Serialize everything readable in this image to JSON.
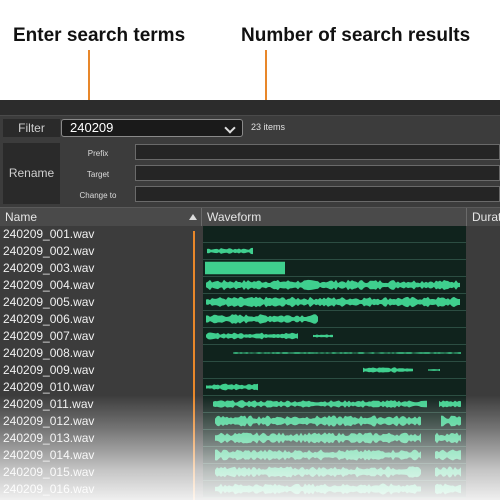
{
  "callouts": {
    "search_terms": "Enter search terms",
    "result_count": "Number of search results"
  },
  "filter": {
    "label": "Filter",
    "value": "240209",
    "count": "23 items"
  },
  "rename": {
    "label": "Rename",
    "fields": [
      {
        "label": "Prefix",
        "value": ""
      },
      {
        "label": "Target",
        "value": ""
      },
      {
        "label": "Change to",
        "value": ""
      }
    ]
  },
  "columns": [
    {
      "label": "Name",
      "sorted": "ascending"
    },
    {
      "label": "Waveform"
    },
    {
      "label": "Durat"
    }
  ],
  "files": [
    "240209_001.wav",
    "240209_002.wav",
    "240209_003.wav",
    "240209_004.wav",
    "240209_005.wav",
    "240209_006.wav",
    "240209_007.wav",
    "240209_008.wav",
    "240209_009.wav",
    "240209_010.wav",
    "240209_011.wav",
    "240209_012.wav",
    "240209_013.wav",
    "240209_014.wav",
    "240209_015.wav",
    "240209_016.wav"
  ],
  "colors": {
    "accent": "#e8872a",
    "waveform": "#3fcf8e",
    "waveform_bg": "#10231d"
  }
}
